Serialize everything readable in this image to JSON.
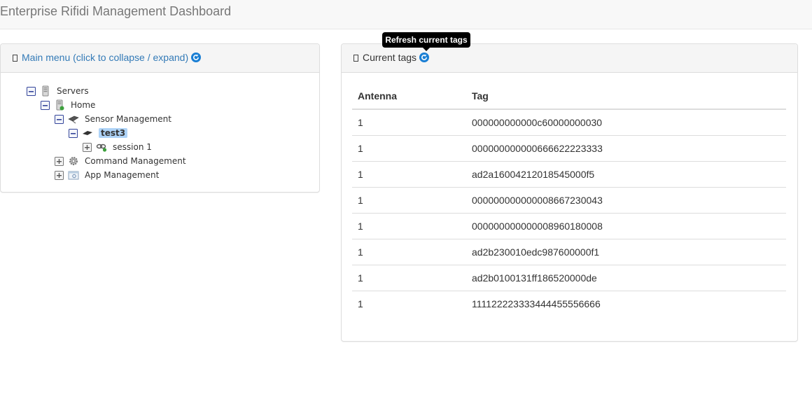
{
  "app": {
    "title": "Enterprise Rifidi Management Dashboard"
  },
  "menu_panel": {
    "title": "Main menu (click to collapse / expand)",
    "icons": {
      "heading": "window-icon",
      "refresh": "refresh-icon"
    },
    "tree": {
      "servers": {
        "label": "Servers",
        "icon": "server-icon",
        "expanded": true
      },
      "home": {
        "label": "Home",
        "icon": "server-icon",
        "expanded": true
      },
      "sensor_management": {
        "label": "Sensor Management",
        "icon": "reader-icon",
        "expanded": true
      },
      "test3": {
        "label": "test3",
        "icon": "reader-device-icon",
        "expanded": true,
        "selected": true
      },
      "session": {
        "label": "session 1",
        "icon": "session-link-icon",
        "expanded": false
      },
      "command_management": {
        "label": "Command Management",
        "icon": "gear-icon",
        "expanded": false
      },
      "app_management": {
        "label": "App Management",
        "icon": "app-window-icon",
        "expanded": false
      }
    }
  },
  "tags_panel": {
    "title": "Current tags",
    "tooltip": "Refresh current tags",
    "columns": {
      "antenna": "Antenna",
      "tag": "Tag"
    },
    "rows": [
      {
        "antenna": "1",
        "tag": "000000000000c60000000030"
      },
      {
        "antenna": "1",
        "tag": "000000000000666622223333"
      },
      {
        "antenna": "1",
        "tag": "ad2a16004212018545000f5"
      },
      {
        "antenna": "1",
        "tag": "000000000000008667230043"
      },
      {
        "antenna": "1",
        "tag": "000000000000008960180008"
      },
      {
        "antenna": "1",
        "tag": "ad2b230010edc987600000f1"
      },
      {
        "antenna": "1",
        "tag": "ad2b0100131ff186520000de"
      },
      {
        "antenna": "1",
        "tag": "111122223333444455556666"
      }
    ]
  },
  "colors": {
    "link": "#337ab7",
    "refresh": "#1a7fd4",
    "selected": "#aed3f7"
  }
}
